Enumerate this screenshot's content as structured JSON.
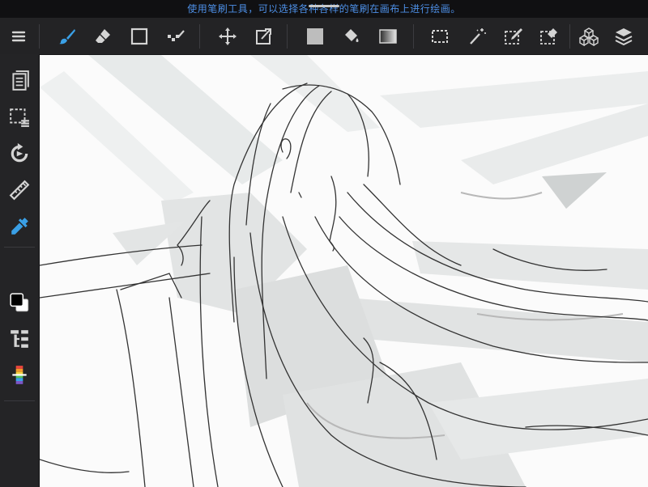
{
  "app": {
    "tip_text": "使用笔刷工具，可以选择各种各样的笔刷在画布上进行绘画。"
  },
  "colors": {
    "accent": "#3aa0e6",
    "toolbar_bg": "#232325",
    "icon": "#d4d4d4",
    "tip_text": "#4d8fe6",
    "canvas_bg": "#fbfbfb",
    "primary_color": "#000000",
    "secondary_color": "#ffffff"
  },
  "toolbar": {
    "items": [
      {
        "icon": "menu-icon"
      },
      {
        "icon": "brush-icon",
        "active": true
      },
      {
        "icon": "eraser-icon"
      },
      {
        "icon": "shape-icon"
      },
      {
        "icon": "filter-icon"
      },
      {
        "icon": "move-icon"
      },
      {
        "icon": "transform-icon"
      },
      {
        "icon": "fill-color-icon"
      },
      {
        "icon": "bucket-icon"
      },
      {
        "icon": "gradient-icon"
      },
      {
        "icon": "selection-icon"
      },
      {
        "icon": "magic-wand-icon"
      },
      {
        "icon": "selection-pen-icon"
      },
      {
        "icon": "selection-eraser-icon"
      },
      {
        "icon": "3d-cubes-icon"
      },
      {
        "icon": "layers-icon"
      }
    ]
  },
  "sidebar": {
    "items": [
      {
        "icon": "pages-icon"
      },
      {
        "icon": "selection-menu-icon"
      },
      {
        "icon": "rotate-icon"
      },
      {
        "icon": "ruler-icon"
      },
      {
        "icon": "eyedropper-icon",
        "active": true
      },
      {
        "icon": "color-swatch-icon"
      },
      {
        "icon": "layer-list-icon"
      },
      {
        "icon": "color-palette-icon"
      }
    ]
  }
}
